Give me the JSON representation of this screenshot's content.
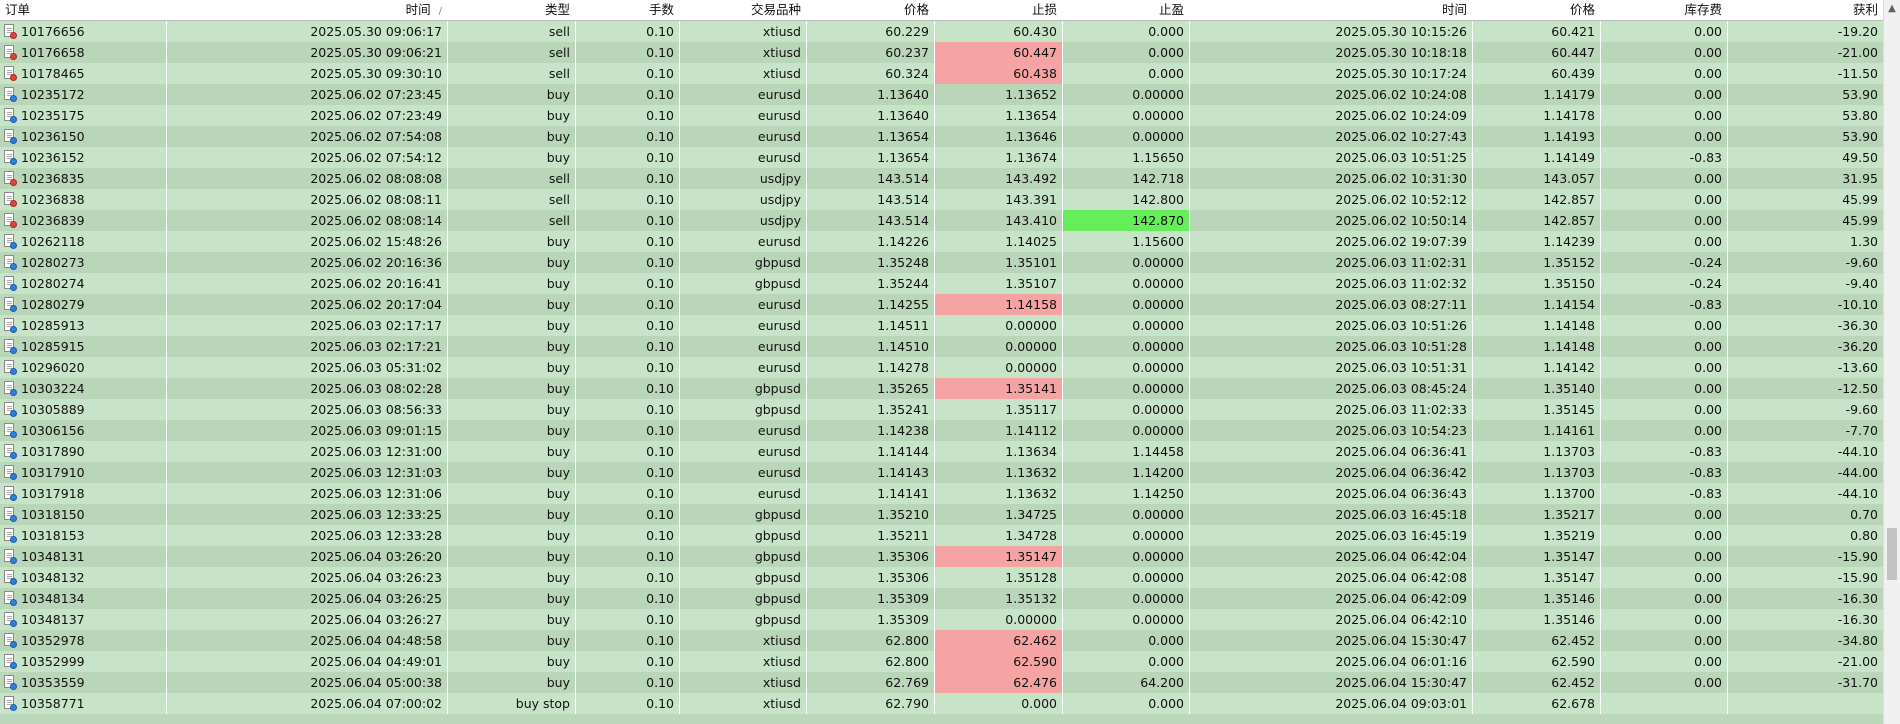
{
  "columns": [
    "订单",
    "时间",
    "类型",
    "手数",
    "交易品种",
    "价格",
    "止损",
    "止盈",
    "时间",
    "价格",
    "库存费",
    "获利"
  ],
  "sort_indicator": "/",
  "scroll_up_glyph": "▲",
  "colors": {
    "row_light": "#c8e4c8",
    "row_dark": "#b9d6b9",
    "stop_hit": "#f6a3a3",
    "tp_hit": "#66ee5a"
  },
  "rows": [
    {
      "dir": "sell",
      "order": "10176656",
      "open_time": "2025.05.30 09:06:17",
      "type": "sell",
      "volume": "0.10",
      "symbol": "xtiusd",
      "price": "60.229",
      "sl": "60.430",
      "tp": "0.000",
      "close_time": "2025.05.30 10:15:26",
      "close_price": "60.421",
      "swap": "0.00",
      "profit": "-19.20"
    },
    {
      "dir": "sell",
      "order": "10176658",
      "open_time": "2025.05.30 09:06:21",
      "type": "sell",
      "volume": "0.10",
      "symbol": "xtiusd",
      "price": "60.237",
      "sl": "60.447",
      "sl_hl": "red",
      "tp": "0.000",
      "close_time": "2025.05.30 10:18:18",
      "close_price": "60.447",
      "swap": "0.00",
      "profit": "-21.00"
    },
    {
      "dir": "sell",
      "order": "10178465",
      "open_time": "2025.05.30 09:30:10",
      "type": "sell",
      "volume": "0.10",
      "symbol": "xtiusd",
      "price": "60.324",
      "sl": "60.438",
      "sl_hl": "red",
      "tp": "0.000",
      "close_time": "2025.05.30 10:17:24",
      "close_price": "60.439",
      "swap": "0.00",
      "profit": "-11.50"
    },
    {
      "dir": "buy",
      "order": "10235172",
      "open_time": "2025.06.02 07:23:45",
      "type": "buy",
      "volume": "0.10",
      "symbol": "eurusd",
      "price": "1.13640",
      "sl": "1.13652",
      "tp": "0.00000",
      "close_time": "2025.06.02 10:24:08",
      "close_price": "1.14179",
      "swap": "0.00",
      "profit": "53.90"
    },
    {
      "dir": "buy",
      "order": "10235175",
      "open_time": "2025.06.02 07:23:49",
      "type": "buy",
      "volume": "0.10",
      "symbol": "eurusd",
      "price": "1.13640",
      "sl": "1.13654",
      "tp": "0.00000",
      "close_time": "2025.06.02 10:24:09",
      "close_price": "1.14178",
      "swap": "0.00",
      "profit": "53.80"
    },
    {
      "dir": "buy",
      "order": "10236150",
      "open_time": "2025.06.02 07:54:08",
      "type": "buy",
      "volume": "0.10",
      "symbol": "eurusd",
      "price": "1.13654",
      "sl": "1.13646",
      "tp": "0.00000",
      "close_time": "2025.06.02 10:27:43",
      "close_price": "1.14193",
      "swap": "0.00",
      "profit": "53.90"
    },
    {
      "dir": "buy",
      "order": "10236152",
      "open_time": "2025.06.02 07:54:12",
      "type": "buy",
      "volume": "0.10",
      "symbol": "eurusd",
      "price": "1.13654",
      "sl": "1.13674",
      "tp": "1.15650",
      "close_time": "2025.06.03 10:51:25",
      "close_price": "1.14149",
      "swap": "-0.83",
      "profit": "49.50"
    },
    {
      "dir": "sell",
      "order": "10236835",
      "open_time": "2025.06.02 08:08:08",
      "type": "sell",
      "volume": "0.10",
      "symbol": "usdjpy",
      "price": "143.514",
      "sl": "143.492",
      "tp": "142.718",
      "close_time": "2025.06.02 10:31:30",
      "close_price": "143.057",
      "swap": "0.00",
      "profit": "31.95"
    },
    {
      "dir": "sell",
      "order": "10236838",
      "open_time": "2025.06.02 08:08:11",
      "type": "sell",
      "volume": "0.10",
      "symbol": "usdjpy",
      "price": "143.514",
      "sl": "143.391",
      "tp": "142.800",
      "close_time": "2025.06.02 10:52:12",
      "close_price": "142.857",
      "swap": "0.00",
      "profit": "45.99"
    },
    {
      "dir": "sell",
      "order": "10236839",
      "open_time": "2025.06.02 08:08:14",
      "type": "sell",
      "volume": "0.10",
      "symbol": "usdjpy",
      "price": "143.514",
      "sl": "143.410",
      "tp": "142.870",
      "tp_hl": "green",
      "close_time": "2025.06.02 10:50:14",
      "close_price": "142.857",
      "swap": "0.00",
      "profit": "45.99"
    },
    {
      "dir": "buy",
      "order": "10262118",
      "open_time": "2025.06.02 15:48:26",
      "type": "buy",
      "volume": "0.10",
      "symbol": "eurusd",
      "price": "1.14226",
      "sl": "1.14025",
      "tp": "1.15600",
      "close_time": "2025.06.02 19:07:39",
      "close_price": "1.14239",
      "swap": "0.00",
      "profit": "1.30"
    },
    {
      "dir": "buy",
      "order": "10280273",
      "open_time": "2025.06.02 20:16:36",
      "type": "buy",
      "volume": "0.10",
      "symbol": "gbpusd",
      "price": "1.35248",
      "sl": "1.35101",
      "tp": "0.00000",
      "close_time": "2025.06.03 11:02:31",
      "close_price": "1.35152",
      "swap": "-0.24",
      "profit": "-9.60"
    },
    {
      "dir": "buy",
      "order": "10280274",
      "open_time": "2025.06.02 20:16:41",
      "type": "buy",
      "volume": "0.10",
      "symbol": "gbpusd",
      "price": "1.35244",
      "sl": "1.35107",
      "tp": "0.00000",
      "close_time": "2025.06.03 11:02:32",
      "close_price": "1.35150",
      "swap": "-0.24",
      "profit": "-9.40"
    },
    {
      "dir": "buy",
      "order": "10280279",
      "open_time": "2025.06.02 20:17:04",
      "type": "buy",
      "volume": "0.10",
      "symbol": "eurusd",
      "price": "1.14255",
      "sl": "1.14158",
      "sl_hl": "red",
      "tp": "0.00000",
      "close_time": "2025.06.03 08:27:11",
      "close_price": "1.14154",
      "swap": "-0.83",
      "profit": "-10.10"
    },
    {
      "dir": "buy",
      "order": "10285913",
      "open_time": "2025.06.03 02:17:17",
      "type": "buy",
      "volume": "0.10",
      "symbol": "eurusd",
      "price": "1.14511",
      "sl": "0.00000",
      "tp": "0.00000",
      "close_time": "2025.06.03 10:51:26",
      "close_price": "1.14148",
      "swap": "0.00",
      "profit": "-36.30"
    },
    {
      "dir": "buy",
      "order": "10285915",
      "open_time": "2025.06.03 02:17:21",
      "type": "buy",
      "volume": "0.10",
      "symbol": "eurusd",
      "price": "1.14510",
      "sl": "0.00000",
      "tp": "0.00000",
      "close_time": "2025.06.03 10:51:28",
      "close_price": "1.14148",
      "swap": "0.00",
      "profit": "-36.20"
    },
    {
      "dir": "buy",
      "order": "10296020",
      "open_time": "2025.06.03 05:31:02",
      "type": "buy",
      "volume": "0.10",
      "symbol": "eurusd",
      "price": "1.14278",
      "sl": "0.00000",
      "tp": "0.00000",
      "close_time": "2025.06.03 10:51:31",
      "close_price": "1.14142",
      "swap": "0.00",
      "profit": "-13.60"
    },
    {
      "dir": "buy",
      "order": "10303224",
      "open_time": "2025.06.03 08:02:28",
      "type": "buy",
      "volume": "0.10",
      "symbol": "gbpusd",
      "price": "1.35265",
      "sl": "1.35141",
      "sl_hl": "red",
      "tp": "0.00000",
      "close_time": "2025.06.03 08:45:24",
      "close_price": "1.35140",
      "swap": "0.00",
      "profit": "-12.50"
    },
    {
      "dir": "buy",
      "order": "10305889",
      "open_time": "2025.06.03 08:56:33",
      "type": "buy",
      "volume": "0.10",
      "symbol": "gbpusd",
      "price": "1.35241",
      "sl": "1.35117",
      "tp": "0.00000",
      "close_time": "2025.06.03 11:02:33",
      "close_price": "1.35145",
      "swap": "0.00",
      "profit": "-9.60"
    },
    {
      "dir": "buy",
      "order": "10306156",
      "open_time": "2025.06.03 09:01:15",
      "type": "buy",
      "volume": "0.10",
      "symbol": "eurusd",
      "price": "1.14238",
      "sl": "1.14112",
      "tp": "0.00000",
      "close_time": "2025.06.03 10:54:23",
      "close_price": "1.14161",
      "swap": "0.00",
      "profit": "-7.70"
    },
    {
      "dir": "buy",
      "order": "10317890",
      "open_time": "2025.06.03 12:31:00",
      "type": "buy",
      "volume": "0.10",
      "symbol": "eurusd",
      "price": "1.14144",
      "sl": "1.13634",
      "tp": "1.14458",
      "close_time": "2025.06.04 06:36:41",
      "close_price": "1.13703",
      "swap": "-0.83",
      "profit": "-44.10"
    },
    {
      "dir": "buy",
      "order": "10317910",
      "open_time": "2025.06.03 12:31:03",
      "type": "buy",
      "volume": "0.10",
      "symbol": "eurusd",
      "price": "1.14143",
      "sl": "1.13632",
      "tp": "1.14200",
      "close_time": "2025.06.04 06:36:42",
      "close_price": "1.13703",
      "swap": "-0.83",
      "profit": "-44.00"
    },
    {
      "dir": "buy",
      "order": "10317918",
      "open_time": "2025.06.03 12:31:06",
      "type": "buy",
      "volume": "0.10",
      "symbol": "eurusd",
      "price": "1.14141",
      "sl": "1.13632",
      "tp": "1.14250",
      "close_time": "2025.06.04 06:36:43",
      "close_price": "1.13700",
      "swap": "-0.83",
      "profit": "-44.10"
    },
    {
      "dir": "buy",
      "order": "10318150",
      "open_time": "2025.06.03 12:33:25",
      "type": "buy",
      "volume": "0.10",
      "symbol": "gbpusd",
      "price": "1.35210",
      "sl": "1.34725",
      "tp": "0.00000",
      "close_time": "2025.06.03 16:45:18",
      "close_price": "1.35217",
      "swap": "0.00",
      "profit": "0.70"
    },
    {
      "dir": "buy",
      "order": "10318153",
      "open_time": "2025.06.03 12:33:28",
      "type": "buy",
      "volume": "0.10",
      "symbol": "gbpusd",
      "price": "1.35211",
      "sl": "1.34728",
      "tp": "0.00000",
      "close_time": "2025.06.03 16:45:19",
      "close_price": "1.35219",
      "swap": "0.00",
      "profit": "0.80"
    },
    {
      "dir": "buy",
      "order": "10348131",
      "open_time": "2025.06.04 03:26:20",
      "type": "buy",
      "volume": "0.10",
      "symbol": "gbpusd",
      "price": "1.35306",
      "sl": "1.35147",
      "sl_hl": "red",
      "tp": "0.00000",
      "close_time": "2025.06.04 06:42:04",
      "close_price": "1.35147",
      "swap": "0.00",
      "profit": "-15.90"
    },
    {
      "dir": "buy",
      "order": "10348132",
      "open_time": "2025.06.04 03:26:23",
      "type": "buy",
      "volume": "0.10",
      "symbol": "gbpusd",
      "price": "1.35306",
      "sl": "1.35128",
      "tp": "0.00000",
      "close_time": "2025.06.04 06:42:08",
      "close_price": "1.35147",
      "swap": "0.00",
      "profit": "-15.90"
    },
    {
      "dir": "buy",
      "order": "10348134",
      "open_time": "2025.06.04 03:26:25",
      "type": "buy",
      "volume": "0.10",
      "symbol": "gbpusd",
      "price": "1.35309",
      "sl": "1.35132",
      "tp": "0.00000",
      "close_time": "2025.06.04 06:42:09",
      "close_price": "1.35146",
      "swap": "0.00",
      "profit": "-16.30"
    },
    {
      "dir": "buy",
      "order": "10348137",
      "open_time": "2025.06.04 03:26:27",
      "type": "buy",
      "volume": "0.10",
      "symbol": "gbpusd",
      "price": "1.35309",
      "sl": "0.00000",
      "tp": "0.00000",
      "close_time": "2025.06.04 06:42:10",
      "close_price": "1.35146",
      "swap": "0.00",
      "profit": "-16.30"
    },
    {
      "dir": "buy",
      "order": "10352978",
      "open_time": "2025.06.04 04:48:58",
      "type": "buy",
      "volume": "0.10",
      "symbol": "xtiusd",
      "price": "62.800",
      "sl": "62.462",
      "sl_hl": "red",
      "tp": "0.000",
      "close_time": "2025.06.04 15:30:47",
      "close_price": "62.452",
      "swap": "0.00",
      "profit": "-34.80"
    },
    {
      "dir": "buy",
      "order": "10352999",
      "open_time": "2025.06.04 04:49:01",
      "type": "buy",
      "volume": "0.10",
      "symbol": "xtiusd",
      "price": "62.800",
      "sl": "62.590",
      "sl_hl": "red",
      "tp": "0.000",
      "close_time": "2025.06.04 06:01:16",
      "close_price": "62.590",
      "swap": "0.00",
      "profit": "-21.00"
    },
    {
      "dir": "buy",
      "order": "10353559",
      "open_time": "2025.06.04 05:00:38",
      "type": "buy",
      "volume": "0.10",
      "symbol": "xtiusd",
      "price": "62.769",
      "sl": "62.476",
      "sl_hl": "red",
      "tp": "64.200",
      "close_time": "2025.06.04 15:30:47",
      "close_price": "62.452",
      "swap": "0.00",
      "profit": "-31.70"
    },
    {
      "dir": "buy",
      "order": "10358771",
      "open_time": "2025.06.04 07:00:02",
      "type": "buy stop",
      "volume": "0.10",
      "symbol": "xtiusd",
      "price": "62.790",
      "sl": "0.000",
      "tp": "0.000",
      "close_time": "2025.06.04 09:03:01",
      "close_price": "62.678",
      "swap": "",
      "profit": ""
    }
  ]
}
